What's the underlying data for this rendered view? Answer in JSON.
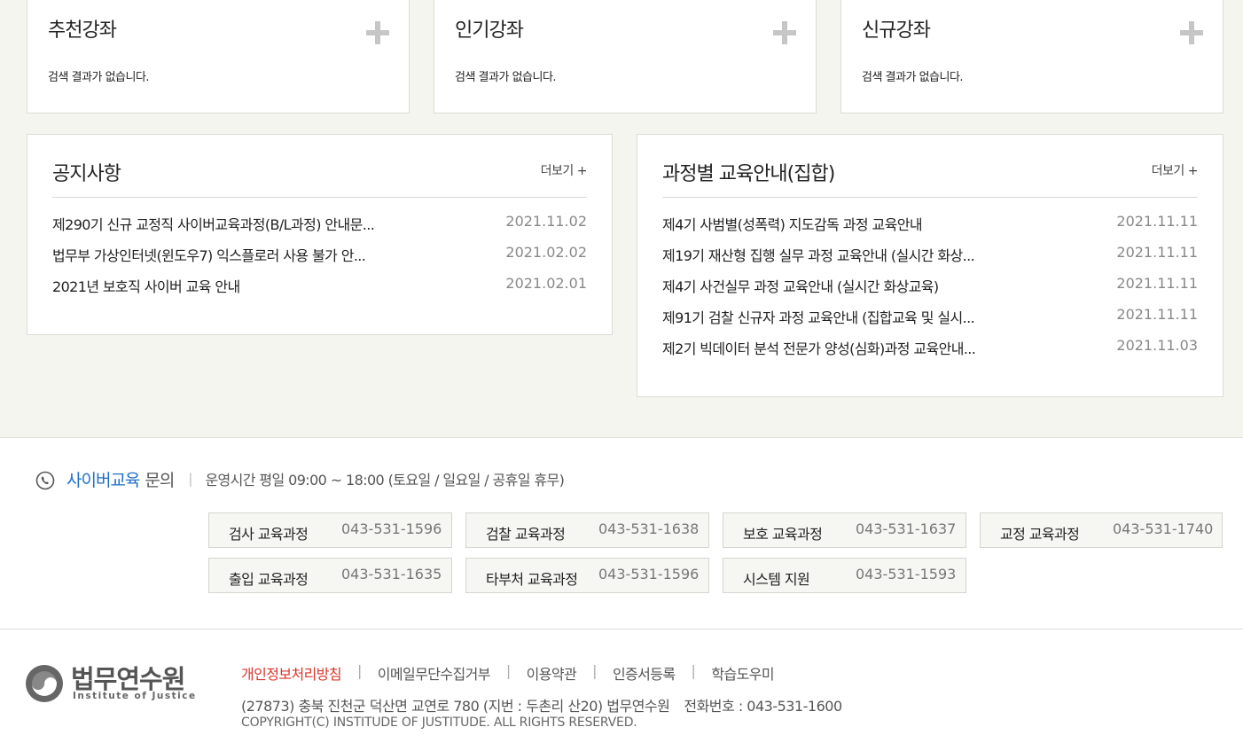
{
  "course_boxes": [
    {
      "title": "추천강좌",
      "empty_text": "검색 결과가 없습니다."
    },
    {
      "title": "인기강좌",
      "empty_text": "검색 결과가 없습니다."
    },
    {
      "title": "신규강좌",
      "empty_text": "검색 결과가 없습니다."
    }
  ],
  "notice": {
    "title": "공지사항",
    "more_label": "더보기 +",
    "items": [
      {
        "title": "제290기 신규 교정직 사이버교육과정(B/L과정) 안내문...",
        "date": "2021.11.02"
      },
      {
        "title": "법무부 가상인터넷(윈도우7) 익스플로러 사용 불가 안...",
        "date": "2021.02.02"
      },
      {
        "title": "2021년 보호직 사이버 교육 안내",
        "date": "2021.02.01"
      }
    ]
  },
  "course_guide": {
    "title": "과정별 교육안내(집합)",
    "more_label": "더보기 +",
    "items": [
      {
        "title": "제4기 사범별(성폭력) 지도감독 과정 교육안내",
        "date": "2021.11.11"
      },
      {
        "title": "제19기 재산형 집행 실무 과정 교육안내 (실시간 화상...",
        "date": "2021.11.11"
      },
      {
        "title": "제4기 사건실무 과정 교육안내 (실시간 화상교육)",
        "date": "2021.11.11"
      },
      {
        "title": "제91기 검찰 신규자 과정 교육안내 (집합교육 및 실시...",
        "date": "2021.11.11"
      },
      {
        "title": "제2기 빅데이터 분석 전문가 양성(심화)과정 교육안내...",
        "date": "2021.11.03"
      }
    ]
  },
  "inquiry": {
    "icon": "phone-icon",
    "label_highlight": "사이버교육",
    "label_rest": "문의",
    "separator": "|",
    "hours": "운영시간 평일 09:00 ~ 18:00 (토요일 / 일요일 / 공휴일 휴무)",
    "contacts": [
      {
        "name": "검사 교육과정",
        "phone": "043-531-1596"
      },
      {
        "name": "검찰 교육과정",
        "phone": "043-531-1638"
      },
      {
        "name": "보호 교육과정",
        "phone": "043-531-1637"
      },
      {
        "name": "교정 교육과정",
        "phone": "043-531-1740"
      },
      {
        "name": "출입 교육과정",
        "phone": "043-531-1635"
      },
      {
        "name": "타부처 교육과정",
        "phone": "043-531-1596"
      },
      {
        "name": "시스템 지원",
        "phone": "043-531-1593"
      }
    ]
  },
  "footer": {
    "logo_text": "법무연수원",
    "logo_subtext": "Institute of Justice",
    "links": [
      "개인정보처리방침",
      "이메일무단수집거부",
      "이용약관",
      "인증서등록",
      "학습도우미"
    ],
    "link_separator": "|",
    "address": "(27873) 충북 진천군 덕산면 교연로 780 (지번 : 두촌리 산20) 법무연수원",
    "tel": "전화번호 : 043-531-1600",
    "copyright": "COPYRIGHT(C) INSTITUDE OF JUSTITUDE. ALL RIGHTS RESERVED."
  },
  "colors": {
    "accent_blue": "#1f6fc6",
    "privacy_red": "#d9342b",
    "background": "#f5f5f0"
  }
}
